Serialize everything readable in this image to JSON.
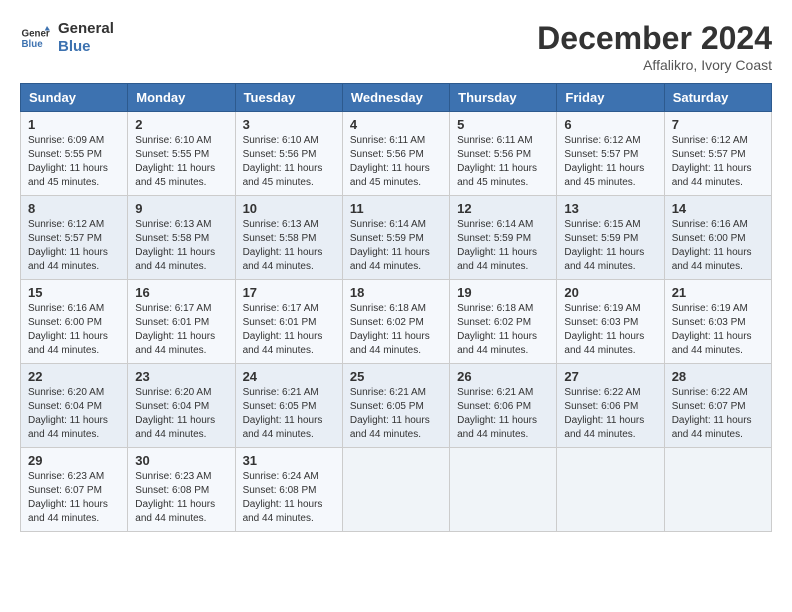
{
  "logo": {
    "line1": "General",
    "line2": "Blue"
  },
  "title": "December 2024",
  "subtitle": "Affalikro, Ivory Coast",
  "weekdays": [
    "Sunday",
    "Monday",
    "Tuesday",
    "Wednesday",
    "Thursday",
    "Friday",
    "Saturday"
  ],
  "weeks": [
    [
      {
        "day": "1",
        "sunrise": "6:09 AM",
        "sunset": "5:55 PM",
        "daylight": "11 hours and 45 minutes."
      },
      {
        "day": "2",
        "sunrise": "6:10 AM",
        "sunset": "5:55 PM",
        "daylight": "11 hours and 45 minutes."
      },
      {
        "day": "3",
        "sunrise": "6:10 AM",
        "sunset": "5:56 PM",
        "daylight": "11 hours and 45 minutes."
      },
      {
        "day": "4",
        "sunrise": "6:11 AM",
        "sunset": "5:56 PM",
        "daylight": "11 hours and 45 minutes."
      },
      {
        "day": "5",
        "sunrise": "6:11 AM",
        "sunset": "5:56 PM",
        "daylight": "11 hours and 45 minutes."
      },
      {
        "day": "6",
        "sunrise": "6:12 AM",
        "sunset": "5:57 PM",
        "daylight": "11 hours and 45 minutes."
      },
      {
        "day": "7",
        "sunrise": "6:12 AM",
        "sunset": "5:57 PM",
        "daylight": "11 hours and 44 minutes."
      }
    ],
    [
      {
        "day": "8",
        "sunrise": "6:12 AM",
        "sunset": "5:57 PM",
        "daylight": "11 hours and 44 minutes."
      },
      {
        "day": "9",
        "sunrise": "6:13 AM",
        "sunset": "5:58 PM",
        "daylight": "11 hours and 44 minutes."
      },
      {
        "day": "10",
        "sunrise": "6:13 AM",
        "sunset": "5:58 PM",
        "daylight": "11 hours and 44 minutes."
      },
      {
        "day": "11",
        "sunrise": "6:14 AM",
        "sunset": "5:59 PM",
        "daylight": "11 hours and 44 minutes."
      },
      {
        "day": "12",
        "sunrise": "6:14 AM",
        "sunset": "5:59 PM",
        "daylight": "11 hours and 44 minutes."
      },
      {
        "day": "13",
        "sunrise": "6:15 AM",
        "sunset": "5:59 PM",
        "daylight": "11 hours and 44 minutes."
      },
      {
        "day": "14",
        "sunrise": "6:16 AM",
        "sunset": "6:00 PM",
        "daylight": "11 hours and 44 minutes."
      }
    ],
    [
      {
        "day": "15",
        "sunrise": "6:16 AM",
        "sunset": "6:00 PM",
        "daylight": "11 hours and 44 minutes."
      },
      {
        "day": "16",
        "sunrise": "6:17 AM",
        "sunset": "6:01 PM",
        "daylight": "11 hours and 44 minutes."
      },
      {
        "day": "17",
        "sunrise": "6:17 AM",
        "sunset": "6:01 PM",
        "daylight": "11 hours and 44 minutes."
      },
      {
        "day": "18",
        "sunrise": "6:18 AM",
        "sunset": "6:02 PM",
        "daylight": "11 hours and 44 minutes."
      },
      {
        "day": "19",
        "sunrise": "6:18 AM",
        "sunset": "6:02 PM",
        "daylight": "11 hours and 44 minutes."
      },
      {
        "day": "20",
        "sunrise": "6:19 AM",
        "sunset": "6:03 PM",
        "daylight": "11 hours and 44 minutes."
      },
      {
        "day": "21",
        "sunrise": "6:19 AM",
        "sunset": "6:03 PM",
        "daylight": "11 hours and 44 minutes."
      }
    ],
    [
      {
        "day": "22",
        "sunrise": "6:20 AM",
        "sunset": "6:04 PM",
        "daylight": "11 hours and 44 minutes."
      },
      {
        "day": "23",
        "sunrise": "6:20 AM",
        "sunset": "6:04 PM",
        "daylight": "11 hours and 44 minutes."
      },
      {
        "day": "24",
        "sunrise": "6:21 AM",
        "sunset": "6:05 PM",
        "daylight": "11 hours and 44 minutes."
      },
      {
        "day": "25",
        "sunrise": "6:21 AM",
        "sunset": "6:05 PM",
        "daylight": "11 hours and 44 minutes."
      },
      {
        "day": "26",
        "sunrise": "6:21 AM",
        "sunset": "6:06 PM",
        "daylight": "11 hours and 44 minutes."
      },
      {
        "day": "27",
        "sunrise": "6:22 AM",
        "sunset": "6:06 PM",
        "daylight": "11 hours and 44 minutes."
      },
      {
        "day": "28",
        "sunrise": "6:22 AM",
        "sunset": "6:07 PM",
        "daylight": "11 hours and 44 minutes."
      }
    ],
    [
      {
        "day": "29",
        "sunrise": "6:23 AM",
        "sunset": "6:07 PM",
        "daylight": "11 hours and 44 minutes."
      },
      {
        "day": "30",
        "sunrise": "6:23 AM",
        "sunset": "6:08 PM",
        "daylight": "11 hours and 44 minutes."
      },
      {
        "day": "31",
        "sunrise": "6:24 AM",
        "sunset": "6:08 PM",
        "daylight": "11 hours and 44 minutes."
      },
      null,
      null,
      null,
      null
    ]
  ],
  "labels": {
    "sunrise_prefix": "Sunrise: ",
    "sunset_prefix": "Sunset: ",
    "daylight_prefix": "Daylight: "
  }
}
